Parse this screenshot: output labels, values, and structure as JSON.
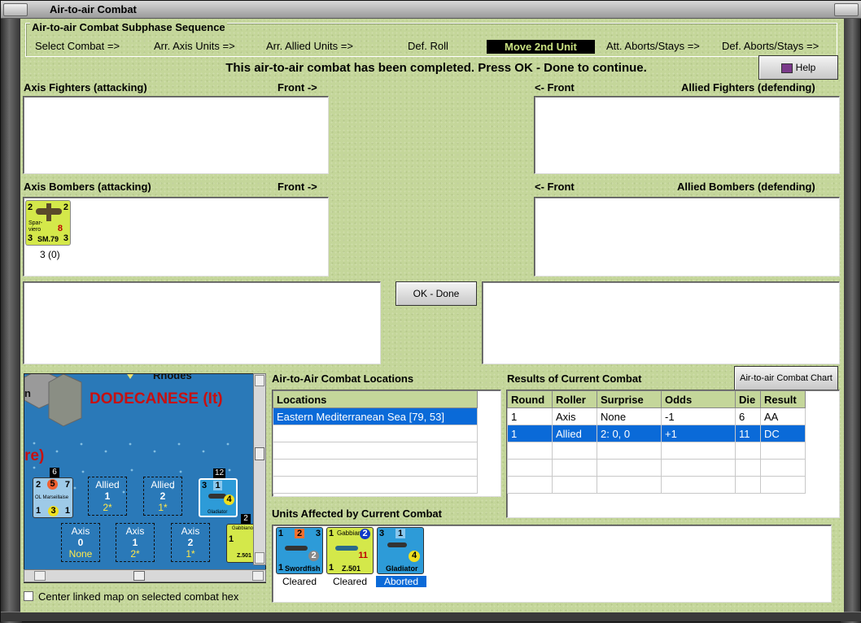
{
  "window": {
    "title": "Air-to-air Combat"
  },
  "phase": {
    "title": "Air-to-air Combat Subphase Sequence",
    "steps": [
      "Select Combat =>",
      "Arr. Axis Units =>",
      "Arr. Allied Units =>",
      "Def. Roll",
      "Move 2nd Unit",
      "Att. Aborts/Stays =>",
      "Def. Aborts/Stays =>"
    ],
    "active_step": "Move 2nd Unit"
  },
  "message": "This air-to-air combat has been completed.  Press OK - Done to continue.",
  "help_label": "Help",
  "labels": {
    "axis_fighters": "Axis Fighters (attacking)",
    "front_right": "Front ->",
    "front_left": "<- Front",
    "allied_fighters": "Allied Fighters (defending)",
    "axis_bombers": "Axis Bombers (attacking)",
    "allied_bombers": "Allied Bombers (defending)",
    "locations_title": "Air-to-Air Combat Locations",
    "results_title": "Results of Current Combat",
    "affected_title": "Units Affected by Current Combat",
    "center_map": "Center linked map on selected combat hex"
  },
  "buttons": {
    "ok_done": "OK - Done",
    "combat_chart": "Air-to-air Combat Chart"
  },
  "axis_bomber_unit": {
    "name": "SM.79",
    "subname": "Spar-viero",
    "tl": "2",
    "tr": "2",
    "bl": "3",
    "br": "3",
    "val": "8",
    "caption": "3 (0)"
  },
  "locations": {
    "header": "Locations",
    "rows": [
      "Eastern Mediterranean Sea [79, 53]"
    ]
  },
  "results": {
    "headers": [
      "Round",
      "Roller",
      "Surprise",
      "Odds",
      "Die",
      "Result"
    ],
    "rows": [
      [
        "1",
        "Axis",
        "None",
        "-1",
        "6",
        "AA"
      ],
      [
        "1",
        "Allied",
        "2: 0, 0",
        "+1",
        "11",
        "DC"
      ]
    ]
  },
  "map": {
    "region": "DODECANESE (It)",
    "island": "Rhodes",
    "partial_left": "n",
    "partial_re": "re)",
    "stack1_count": "6",
    "stack2_count": "12",
    "stack3_count": "2",
    "ship": {
      "name": "OL Marseillaise",
      "tl": "2",
      "tm": "5",
      "tr": "7",
      "bl": "1",
      "bm": "3",
      "br": "1"
    },
    "gladiator": {
      "name": "Gladiator",
      "tl": "3",
      "tm": "1",
      "br": "4"
    },
    "gabbiano": {
      "name": "Z.501",
      "tl": "1",
      "sub": "Gabbiano"
    },
    "boxes": [
      {
        "side": "Allied",
        "num": "1",
        "val": "2*"
      },
      {
        "side": "Allied",
        "num": "2",
        "val": "1*"
      },
      {
        "side": "Axis",
        "num": "0",
        "val": "None"
      },
      {
        "side": "Axis",
        "num": "1",
        "val": "2*"
      },
      {
        "side": "Axis",
        "num": "2",
        "val": "1*"
      }
    ]
  },
  "affected": [
    {
      "name": "Swordfish",
      "tl": "1",
      "tm": "2",
      "tr": "3",
      "bl": "1",
      "bm": "2",
      "caption": "Cleared",
      "bg": "#2d9bd8"
    },
    {
      "name": "Z.501",
      "sub": "Gabbiano",
      "tl": "1",
      "tm": "2",
      "bl": "1",
      "val": "11",
      "caption": "Cleared",
      "bg": "#d4e84a"
    },
    {
      "name": "Gladiator",
      "tl": "3",
      "tm": "1",
      "val": "4",
      "caption": "Aborted",
      "bg": "#2d9bd8"
    }
  ]
}
